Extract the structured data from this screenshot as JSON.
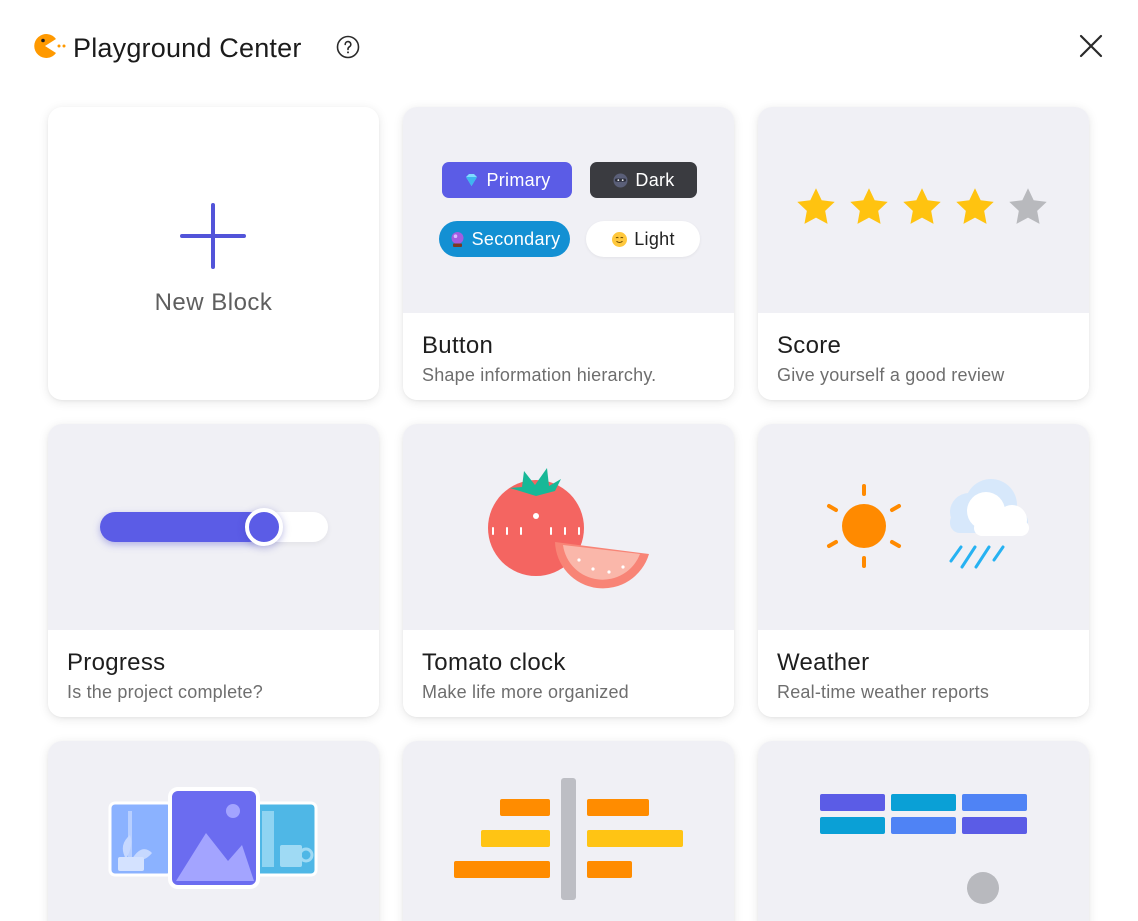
{
  "header": {
    "title": "Playground Center",
    "help_icon": "question-circle-icon",
    "close_icon": "close-icon",
    "logo_icon": "pacman-logo-icon"
  },
  "colors": {
    "accent": "#5b5ce6",
    "star_filled": "#ffc310",
    "star_empty": "#b8b9bd",
    "sun": "#ff8a00",
    "rain": "#26b2f2",
    "tomato": "#f46561",
    "stem": "#17b897",
    "bar_orange": "#ff8c00",
    "bar_yellow": "#ffc414",
    "heat_blue": "#5b5ce6",
    "heat_cyan": "#0aa0d6",
    "heat_light": "#4f83f5"
  },
  "new_block": {
    "label": "New Block",
    "icon": "plus-icon"
  },
  "cards": [
    {
      "name": "Button",
      "desc": "Shape information hierarchy.",
      "buttons": {
        "primary": "Primary",
        "dark": "Dark",
        "secondary": "Secondary",
        "light": "Light"
      }
    },
    {
      "name": "Score",
      "desc": "Give yourself a good review",
      "rating": 4,
      "max": 5
    },
    {
      "name": "Progress",
      "desc": "Is the project complete?",
      "progress": 0.72
    },
    {
      "name": "Tomato clock",
      "desc": "Make life more organized"
    },
    {
      "name": "Weather",
      "desc": "Real-time weather reports"
    }
  ]
}
